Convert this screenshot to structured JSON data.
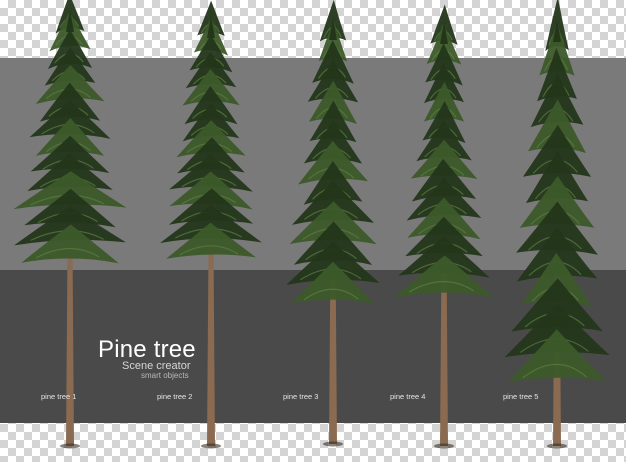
{
  "banner": {
    "title": "Pine tree",
    "subtitle": "Scene creator",
    "tagline": "smart objects"
  },
  "trees": [
    {
      "label": "pine tree 1",
      "icon": "pine-tree-icon"
    },
    {
      "label": "pine tree 2",
      "icon": "pine-tree-icon"
    },
    {
      "label": "pine tree 3",
      "icon": "pine-tree-icon"
    },
    {
      "label": "pine tree 4",
      "icon": "pine-tree-icon"
    },
    {
      "label": "pine tree 5",
      "icon": "pine-tree-icon"
    }
  ],
  "colors": {
    "checker_light": "#ffffff",
    "checker_dark": "#d4d4d4",
    "panel_upper": "#7a7a7a",
    "panel_lower": "#4a4a4a",
    "foliage_dark": "#23361a",
    "foliage_mid": "#3c5a2a",
    "foliage_light": "#5e7d42",
    "trunk": "#8a6a50"
  }
}
